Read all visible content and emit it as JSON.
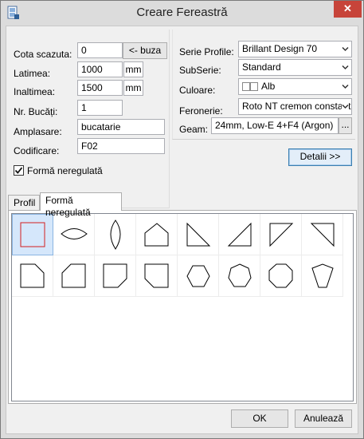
{
  "window": {
    "title": "Creare Fereastră",
    "close_glyph": "✕"
  },
  "left": {
    "cota": {
      "label": "Cota scazuta:",
      "value": "0",
      "button": "<- buza"
    },
    "latimea": {
      "label": "Latimea:",
      "value": "1000",
      "unit": "mm"
    },
    "inaltimea": {
      "label": "Inaltimea:",
      "value": "1500",
      "unit": "mm"
    },
    "nr_bucati": {
      "label": "Nr. Bucăți:",
      "value": "1"
    },
    "amplasare": {
      "label": "Amplasare:",
      "value": "bucatarie"
    },
    "codificare": {
      "label": "Codificare:",
      "value": "F02"
    },
    "forma_neregulata": {
      "label": "Formă neregulată",
      "checked": true
    }
  },
  "right": {
    "serie": {
      "label": "Serie Profile:",
      "value": "Brillant Design 70"
    },
    "subserie": {
      "label": "SubSerie:",
      "value": "Standard"
    },
    "culoare": {
      "label": "Culoare:",
      "value": "Alb"
    },
    "feronerie": {
      "label": "Feronerie:",
      "value": "Roto NT cremon constant"
    },
    "geam": {
      "label": "Geam:",
      "value": "24mm, Low-E 4+F4 (Argon)",
      "button": "..."
    },
    "detalii_button": "Detalii >>"
  },
  "tabs": [
    {
      "label": "Profil",
      "active": false
    },
    {
      "label": "Formă neregulată",
      "active": true
    }
  ],
  "shapes": [
    {
      "name": "rectangle-shape",
      "selected": true
    },
    {
      "name": "ellipse-horizontal-shape"
    },
    {
      "name": "ellipse-vertical-shape"
    },
    {
      "name": "pentagon-house-shape"
    },
    {
      "name": "triangle-right-bottom-left-shape"
    },
    {
      "name": "triangle-right-bottom-right-shape"
    },
    {
      "name": "triangle-top-left-shape"
    },
    {
      "name": "triangle-top-right-shape"
    },
    {
      "name": "chamfer-top-right-shape"
    },
    {
      "name": "chamfer-top-left-shape"
    },
    {
      "name": "chamfer-bottom-right-shape"
    },
    {
      "name": "chamfer-bottom-left-shape"
    },
    {
      "name": "hexagon-shape"
    },
    {
      "name": "heptagon-shape"
    },
    {
      "name": "octagon-shape"
    },
    {
      "name": "pentagon-inverted-shape"
    }
  ],
  "footer": {
    "ok": "OK",
    "cancel": "Anulează"
  }
}
